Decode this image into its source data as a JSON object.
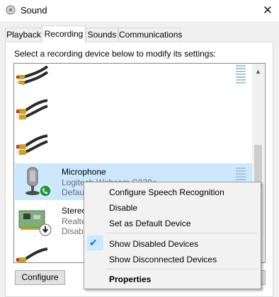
{
  "window": {
    "title": "Sound",
    "close_glyph": "✕"
  },
  "tabs": [
    {
      "label": "Playback",
      "active": false
    },
    {
      "label": "Recording",
      "active": true
    },
    {
      "label": "Sounds",
      "active": false
    },
    {
      "label": "Communications",
      "active": false
    }
  ],
  "instruction": "Select a recording device below to modify its settings:",
  "devices": [
    {
      "icon": "rca-jack-icon"
    },
    {
      "icon": "rca-jack-icon"
    },
    {
      "icon": "rca-jack-icon"
    },
    {
      "icon": "microphone-icon",
      "name": "Microphone",
      "line2": "Logitech Webcam C930e",
      "line3": "Default",
      "status_icon": "green-phone-icon",
      "selected": true
    },
    {
      "icon": "sound-card-icon",
      "name": "Stereo",
      "line2": "Realte",
      "line3": "Disable",
      "status_icon": "disabled-arrow-icon"
    },
    {
      "icon": "rca-jack-icon"
    }
  ],
  "buttons": {
    "configure": "Configure"
  },
  "context_menu": {
    "items": [
      {
        "label": "Configure Speech Recognition"
      },
      {
        "label": "Disable"
      },
      {
        "label": "Set as Default Device"
      },
      {
        "label": "Show Disabled Devices",
        "checked": true
      },
      {
        "label": "Show Disconnected Devices"
      },
      {
        "label": "Properties",
        "bold": true
      }
    ]
  },
  "colors": {
    "selection": "#cce8ff",
    "accent": "#0078d7",
    "status_green": "#1e9e3a"
  }
}
